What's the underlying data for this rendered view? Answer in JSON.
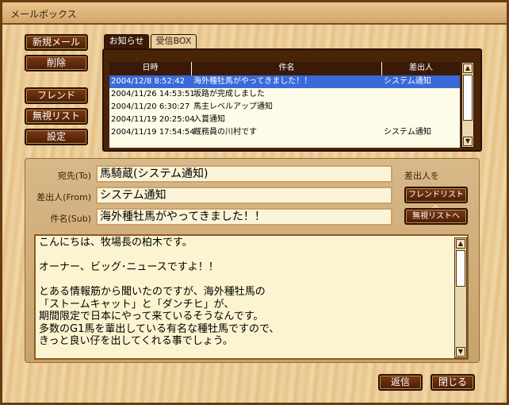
{
  "window": {
    "title": "メールボックス"
  },
  "sidebar": {
    "new_mail": "新規メール",
    "delete": "削除",
    "friend": "フレンド",
    "ignore_list": "無視リスト",
    "settings": "設定"
  },
  "tabs": [
    "お知らせ",
    "受信BOX"
  ],
  "list": {
    "headers": [
      "日時",
      "件名",
      "差出人"
    ],
    "rows": [
      {
        "date": "2004/12/8 8:52:42",
        "subject": "海外種牡馬がやってきました！！",
        "from": "システム通知",
        "selected": true
      },
      {
        "date": "2004/11/26 14:53:51",
        "subject": "坂路が完成しました",
        "from": ""
      },
      {
        "date": "2004/11/20 6:30:27",
        "subject": "馬主レベルアップ通知",
        "from": ""
      },
      {
        "date": "2004/11/19 20:25:04",
        "subject": "入賞通知",
        "from": ""
      },
      {
        "date": "2004/11/19 17:54:54",
        "subject": "厩務員の川村です",
        "from": "システム通知"
      }
    ]
  },
  "detail": {
    "to_label": "宛先(To)",
    "to_value": "馬騎蔵(システム通知)",
    "from_label": "差出人(From)",
    "from_value": "システム通知",
    "subject_label": "件名(Sub)",
    "subject_value": "海外種牡馬がやってきました！！",
    "sender_caption": "差出人を",
    "friend_list_button": "フレンドリストへ",
    "ignore_list_button": "無視リストへ"
  },
  "body_lines": [
    "こんにちは、牧場長の柏木です。",
    "",
    "オーナー、ビッグ･ニュースですよ！！",
    "",
    "とある情報筋から聞いたのですが、海外種牡馬の",
    "「ストームキャット」と「ダンチヒ」が、",
    "期間限定で日本にやって来ているそうなんです。",
    "多数のG1馬を輩出している有名な種牡馬ですので、",
    "きっと良い仔を出してくれる事でしょう。"
  ],
  "footer": {
    "reply": "返信",
    "close": "閉じる"
  }
}
